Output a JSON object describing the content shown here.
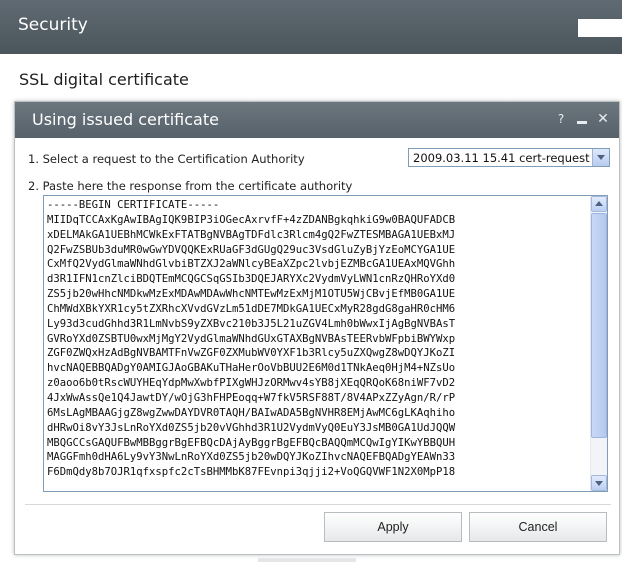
{
  "app": {
    "title": "Security"
  },
  "page": {
    "heading": "SSL digital certificate"
  },
  "dialog": {
    "title": "Using issued certificate",
    "controls": {
      "help": "?",
      "minimize": "minimize",
      "close": "close"
    },
    "step1_label": "1. Select a request to the Certification Authority",
    "request_select": {
      "selected": "2009.03.11 15.41 cert-request"
    },
    "step2_label": "2. Paste here the response from the certificate authority",
    "response_text": "-----BEGIN CERTIFICATE-----\nMIIDqTCCAxKgAwIBAgIQK9BIP3iOGecAxrvfF+4zZDANBgkqhkiG9w0BAQUFADCB\nxDELMAkGA1UEBhMCWkExFTATBgNVBAgTDFdlc3Rlcm4gQ2FwZTESMBAGA1UEBxMJ\nQ2FwZSBUb3duMR0wGwYDVQQKExRUaGF3dGUgQ29uc3VsdGluZyBjYzEoMCYGA1UE\nCxMfQ2VydGlmaWNhdGlvbiBTZXJ2aWNlcyBEaXZpc2lvbjEZMBcGA1UEAxMQVGhh\nd3R1IFN1cnZlciBDQTEmMCQGCSqGSIb3DQEJARYXc2VydmVyLWN1cnRzQHRoYXd0\nZS5jb20wHhcNMDkwMzExMDAwMDAwWhcNMTEwMzExMjM1OTU5WjCBvjEfMB0GA1UE\nChMWdXBkYXR1cy5tZXRhcXVvdGVzLm51dDE7MDkGA1UECxMyR28gdG8gaHR0cHM6\nLy93d3cudGhhd3R1LmNvbS9yZXBvc210b3J5L21uZGV4Lmh0bWwxIjAgBgNVBAsT\nGVRoYXd0ZSBTU0wxMjMgY2VydGlmaWNhdGUxGTAXBgNVBAsTEERvbWFpbiBWYWxp\nZGF0ZWQxHzAdBgNVBAMTFnVwZGF0ZXMubWV0YXF1b3Rlcy5uZXQwgZ8wDQYJKoZI\nhvcNAQEBBQADgY0AMIGJAoGBAKuTHaHerOoVbBUU2E6M0d1TNkAeq0HjM4+NZsUo\nz0aoo6b0tRscWUYHEqYdpMwXwbfPIXgWHJzORMwv4sYB8jXEqQRQoK68niWF7vD2\n4JxWwAssQe1Q4JawtDY/wOjG3hFHPEoqq+W7fkV5RSF88T/8V4APxZZyAgn/R/rP\n6MsLAgMBAAGjgZ8wgZwwDAYDVR0TAQH/BAIwADA5BgNVHR8EMjAwMC6gLKAqhiho\ndHRwOi8vY3JsLnRoYXd0ZS5jb20vVGhhd3R1U2VydmVyQ0EuY3JsMB0GA1UdJQQW\nMBQGCCsGAQUFBwMBBggrBgEFBQcDAjAyBggrBgEFBQcBAQQmMCQwIgYIKwYBBQUH\nMAGGFmh0dHA6Ly9vY3NwLnRoYXd0ZS5jb20wDQYJKoZIhvcNAQEFBQADgYEAWn33\nF6DmQdy8b7OJR1qfxspfc2cTsBHMMbK87FEvnpi3qjji2+VoQGQVWF1N2X0MpP18"
  },
  "buttons": {
    "apply": "Apply",
    "cancel": "Cancel"
  }
}
